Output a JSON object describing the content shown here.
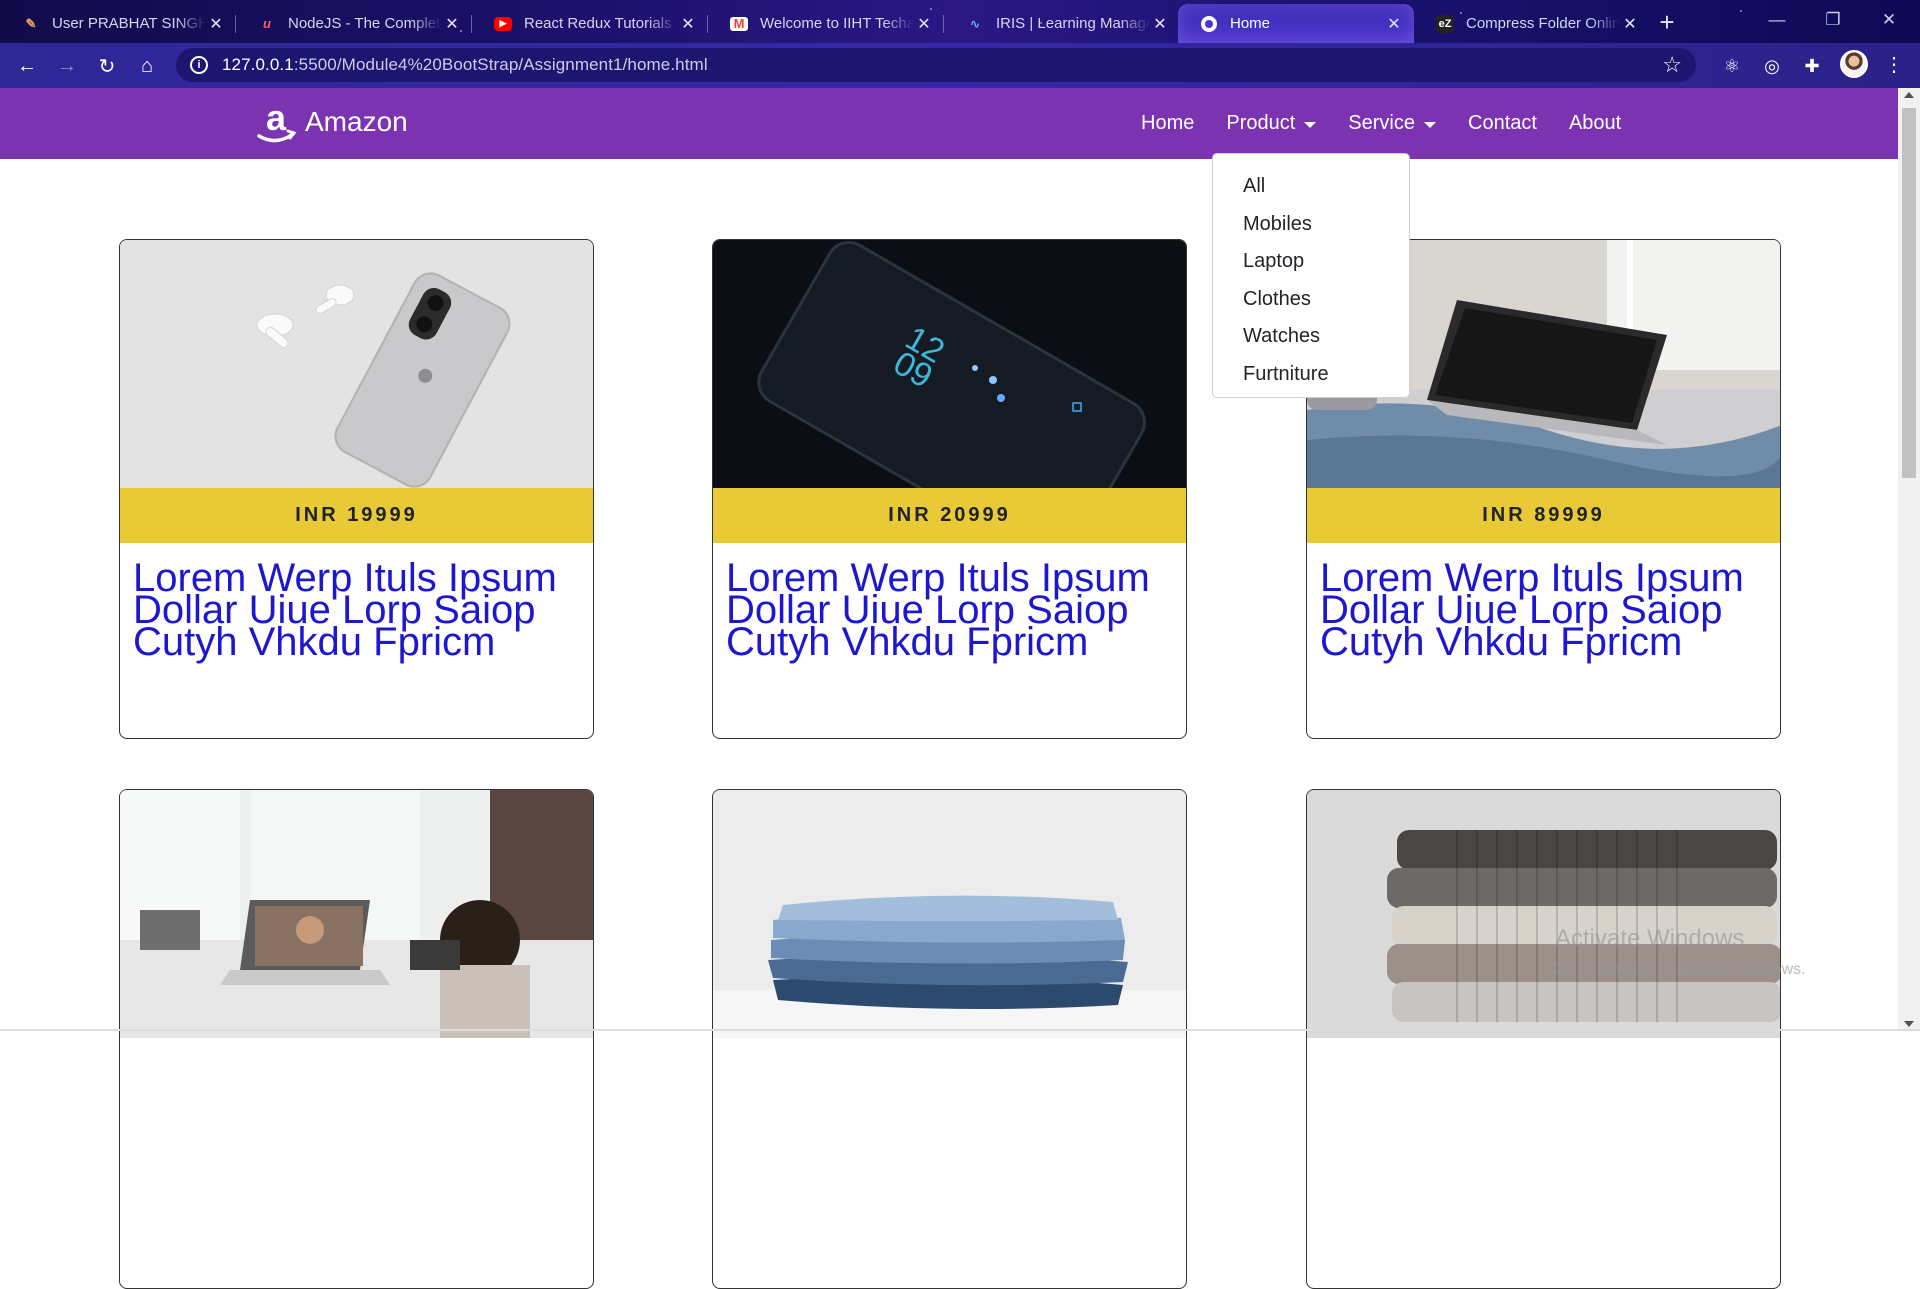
{
  "browser": {
    "tabs": [
      {
        "title": "User PRABHAT SINGH",
        "icon": "tab-favicon-user-icon",
        "color": "#e8a060"
      },
      {
        "title": "NodeJS - The Complete",
        "icon": "udemy-icon",
        "color": "#ff5a5f"
      },
      {
        "title": "React Redux Tutorials",
        "icon": "youtube-icon",
        "color": "#ff0000"
      },
      {
        "title": "Welcome to IIHT Techa",
        "icon": "gmail-icon",
        "color": "#ea4335"
      },
      {
        "title": "IRIS | Learning Manage",
        "icon": "iris-icon",
        "color": "#4a90e2"
      },
      {
        "title": "Home",
        "icon": "globe-icon",
        "color": "#ffffff"
      },
      {
        "title": "Compress Folder Onlin",
        "icon": "ezyzip-icon",
        "color": "#2a2a2a"
      }
    ],
    "url_host": "127.0.0.1",
    "url_path": ":5500/Module4%20BootStrap/Assignment1/home.html"
  },
  "site": {
    "brand": "Amazon",
    "nav": {
      "home": "Home",
      "product": "Product",
      "service": "Service",
      "contact": "Contact",
      "about": "About"
    },
    "dropdown": [
      "All",
      "Mobiles",
      "Laptop",
      "Clothes",
      "Watches",
      "Furtniture"
    ],
    "accent_color": "#7b33b1",
    "price_bar_color": "#e8c936",
    "description_color": "#1d17cf"
  },
  "cards": [
    {
      "price": "INR 19999",
      "desc": "Lorem Werp Ituls Ipsum Dollar Uiue Lorp Saiop Cutyh Vhkdu Fpricm",
      "image": "white iPhone with AirPods"
    },
    {
      "price": "INR 20999",
      "desc": "Lorem Werp Ituls Ipsum Dollar Uiue Lorp Saiop Cutyh Vhkdu Fpricm",
      "image": "dark smartphone lock screen"
    },
    {
      "price": "INR 89999",
      "desc": "Lorem Werp Ituls Ipsum Dollar Uiue Lorp Saiop Cutyh Vhkdu Fpricm",
      "image": "laptop on bed"
    },
    {
      "image": "child with laptop video call"
    },
    {
      "image": "stack of folded jeans"
    },
    {
      "image": "stack of knitted sweaters"
    }
  ],
  "watermark": {
    "line1": "Activate Windows",
    "line2": "Go to Settings to activate Windows."
  }
}
